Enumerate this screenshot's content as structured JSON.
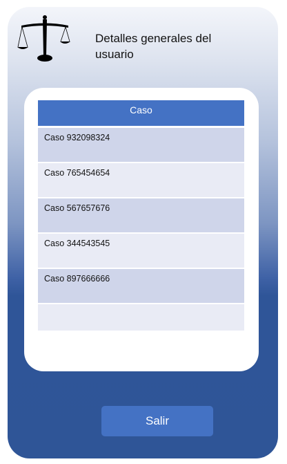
{
  "header": {
    "logo_icon": "scales-of-justice-icon",
    "title": "Detalles generales del usuario"
  },
  "table": {
    "column_header": "Caso",
    "rows": [
      "Caso 932098324",
      "Caso 765454654",
      "Caso 567657676",
      "Caso 344543545",
      "Caso 897666666",
      ""
    ]
  },
  "footer": {
    "exit_label": "Salir"
  },
  "colors": {
    "accent": "#4472c4",
    "background_dark": "#2f5597",
    "row_dark": "#cfd5ea",
    "row_light": "#e9ebf5"
  }
}
